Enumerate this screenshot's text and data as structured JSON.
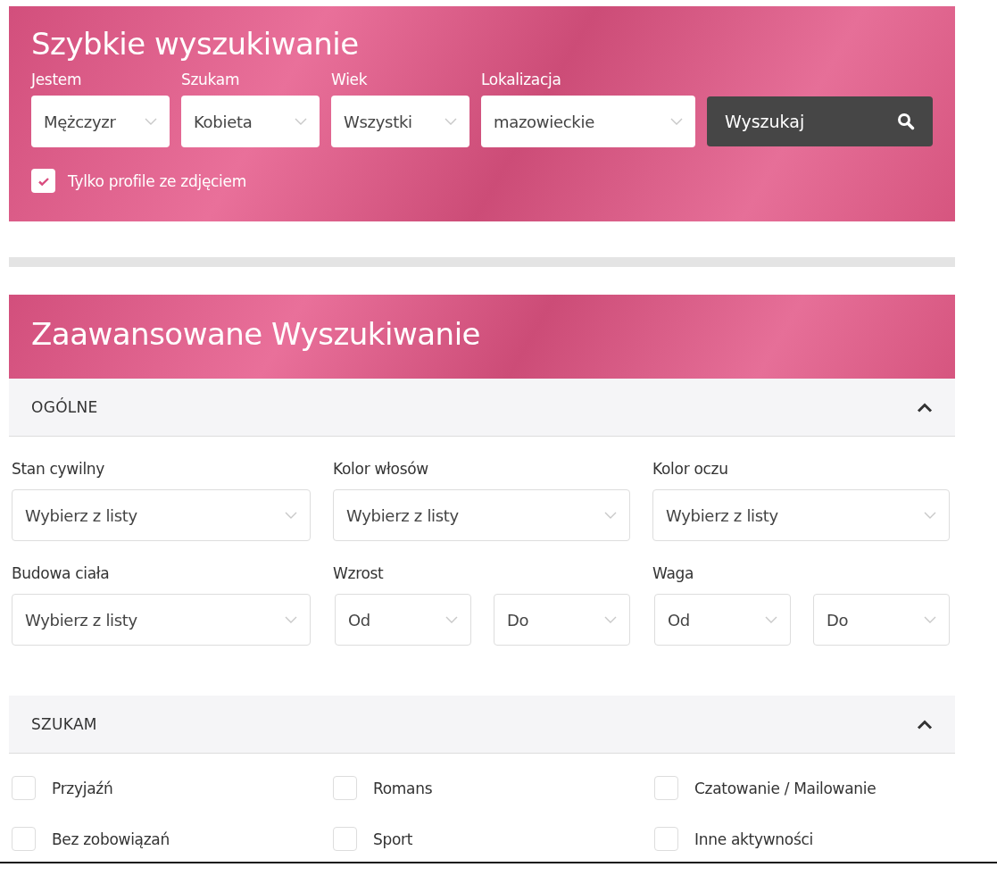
{
  "quick_search": {
    "title": "Szybkie wyszukiwanie",
    "fields": [
      {
        "label": "Jestem",
        "value": "Mężczyzr"
      },
      {
        "label": "Szukam",
        "value": "Kobieta"
      },
      {
        "label": "Wiek",
        "value": "Wszystki"
      },
      {
        "label": "Lokalizacja",
        "value": "mazowieckie"
      }
    ],
    "button": {
      "label": "Wyszukaj"
    },
    "photo_only": {
      "label": "Tylko profile ze zdjęciem",
      "checked": true
    }
  },
  "advanced": {
    "title": "Zaawansowane Wyszukiwanie",
    "sections": [
      {
        "title": "OGÓLNE",
        "expanded": true,
        "kind": "fields",
        "fields": [
          {
            "label": "Stan cywilny",
            "kind": "select",
            "values": [
              "Wybierz z listy"
            ]
          },
          {
            "label": "Kolor włosów",
            "kind": "select",
            "values": [
              "Wybierz z listy"
            ]
          },
          {
            "label": "Kolor oczu",
            "kind": "select",
            "values": [
              "Wybierz z listy"
            ]
          },
          {
            "label": "Budowa ciała",
            "kind": "select",
            "values": [
              "Wybierz z listy"
            ]
          },
          {
            "label": "Wzrost",
            "kind": "range",
            "values": [
              "Od",
              "Do"
            ]
          },
          {
            "label": "Waga",
            "kind": "range",
            "values": [
              "Od",
              "Do"
            ]
          }
        ]
      },
      {
        "title": "SZUKAM",
        "expanded": true,
        "kind": "checkboxes",
        "options": [
          {
            "label": "Przyjaźń",
            "checked": false
          },
          {
            "label": "Romans",
            "checked": false
          },
          {
            "label": "Czatowanie / Mailowanie",
            "checked": false
          },
          {
            "label": "Bez zobowiązań",
            "checked": false
          },
          {
            "label": "Sport",
            "checked": false
          },
          {
            "label": "Inne aktywności",
            "checked": false
          }
        ]
      }
    ]
  }
}
